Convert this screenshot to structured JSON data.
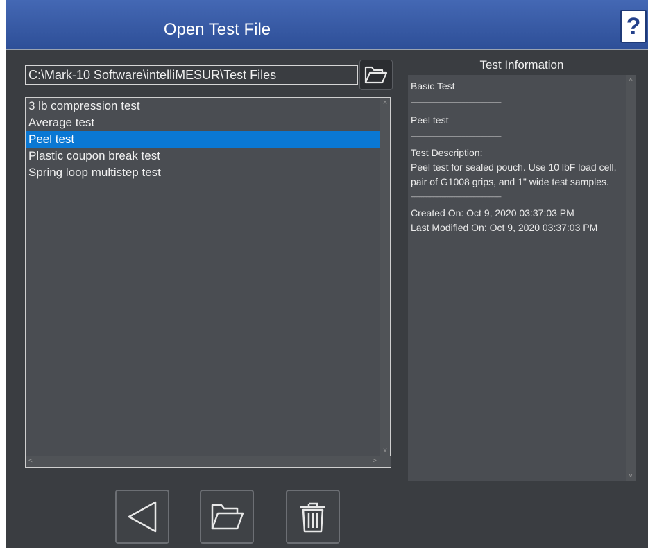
{
  "window": {
    "title": "Open Test File",
    "help_label": "?"
  },
  "path": {
    "value": "C:\\Mark-10 Software\\intelliMESUR\\Test Files"
  },
  "file_list": {
    "items": [
      "3 lb compression test",
      "Average test",
      "Peel test",
      "Plastic coupon break test",
      "Spring loop multistep test"
    ],
    "selected": "Peel test"
  },
  "info": {
    "header": "Test Information",
    "test_type": "Basic Test",
    "name": "Peel test",
    "description_label": "Test Description:",
    "description": "Peel test for sealed pouch. Use 10 lbF load cell, pair of G1008 grips, and 1\" wide test samples.",
    "created": "Created On: Oct 9, 2020 03:37:03 PM",
    "modified": "Last Modified On: Oct 9, 2020 03:37:03 PM"
  },
  "icons": {
    "browse": "folder-open-icon",
    "back": "back-triangle-icon",
    "open": "folder-open-icon",
    "delete": "trash-icon"
  },
  "colors": {
    "titlebar": "#3a5ca8",
    "selection": "#0a78d4",
    "background": "#3a3d41",
    "panel": "#4a4d52"
  }
}
